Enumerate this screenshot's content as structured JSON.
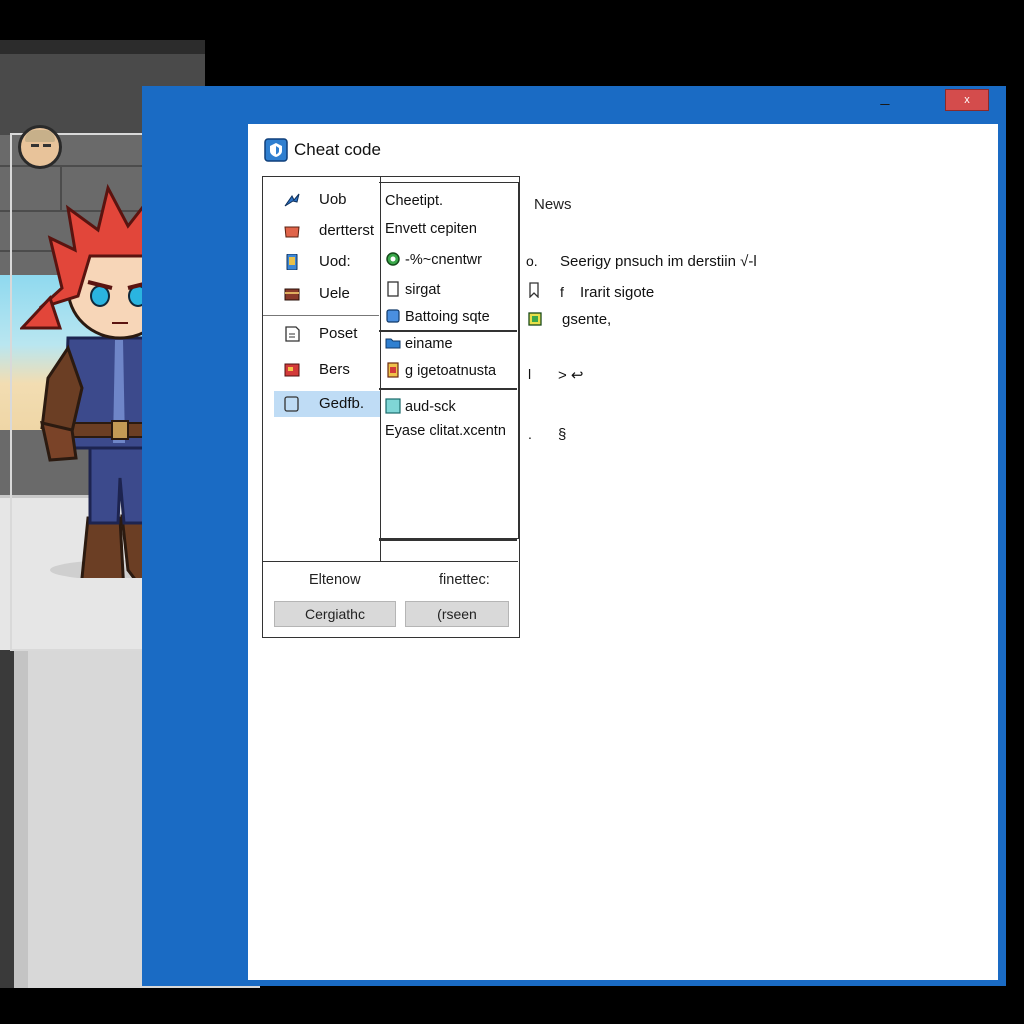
{
  "window": {
    "minimize_glyph": "_",
    "close_glyph": "x"
  },
  "header": {
    "title": "Cheat code",
    "icon": "app-shield-icon"
  },
  "categories": [
    {
      "label": "Uob",
      "icon": "blue-arrow-icon",
      "color": "#2a6fc2"
    },
    {
      "label": "dertterst",
      "icon": "red-chest-icon",
      "color": "#e0644a"
    },
    {
      "label": "Uod:",
      "icon": "phone-icon",
      "color": "#3b86d6"
    },
    {
      "label": "Uele",
      "icon": "brown-box-icon",
      "color": "#8a3a2a"
    },
    {
      "label": "Poset",
      "icon": "document-icon",
      "color": "#333333"
    },
    {
      "label": "Bers",
      "icon": "red-card-icon",
      "color": "#d33a3a"
    },
    {
      "label": "Gedfb.",
      "icon": "square-outline-icon",
      "color": "#333333",
      "selected": true
    }
  ],
  "entries": [
    {
      "label": "Cheetipt."
    },
    {
      "label": "Envett cepiten"
    },
    {
      "label": "-%~cnentwr",
      "icon": "green-gear-icon"
    },
    {
      "label": "sirgat",
      "icon": "page-icon"
    },
    {
      "label": "Battoing sqte",
      "icon": "blue-tag-icon"
    },
    {
      "label": "einame",
      "icon": "folder-icon"
    },
    {
      "label": "g igetoatnusta",
      "icon": "orange-page-icon"
    },
    {
      "label": "aud-sck",
      "icon": "teal-window-icon"
    },
    {
      "label": "Eyase clitat.xcentn"
    }
  ],
  "footer": {
    "left_label": "Eltenow",
    "right_label": "finettec:",
    "left_button": "Cergiathc",
    "right_button": "(rseen"
  },
  "news": {
    "header": "News",
    "lines": [
      {
        "marker": "o.",
        "text": "Seerigy pnsuch im derstiin",
        "suffix": "√-l"
      },
      {
        "marker": "f",
        "text": "Irarit sigote",
        "icon": "bookmark-icon"
      },
      {
        "marker": "",
        "text": "gsente,",
        "icon": "yellow-tag-icon"
      },
      {
        "marker": "l",
        "text": "> ↩"
      },
      {
        "marker": ".",
        "text": "§"
      }
    ]
  },
  "colors": {
    "window_frame": "#1a6bc4",
    "close_button": "#d44c4c",
    "selection": "#bfdcf5",
    "hero_hair": "#e2463a",
    "hero_suit": "#3c4a8c"
  }
}
